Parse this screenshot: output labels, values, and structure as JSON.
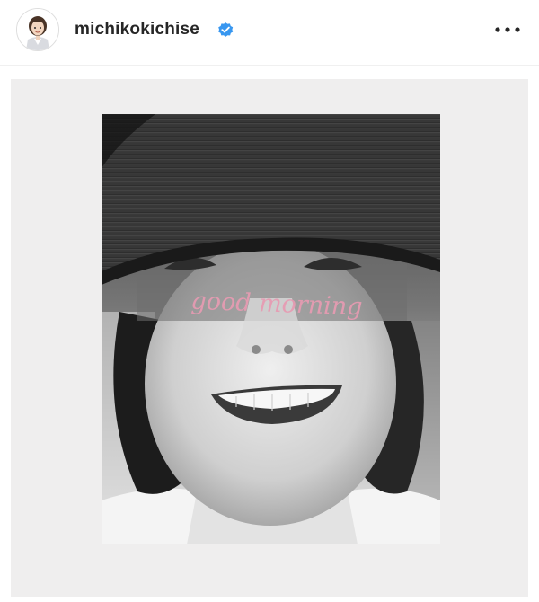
{
  "header": {
    "username": "michikokichise",
    "verified_badge": "verified-badge-icon",
    "more_icon": "more-options-icon"
  },
  "post": {
    "overlay_text": "good morning",
    "overlay_color": "#e79bb2"
  },
  "colors": {
    "verified_blue": "#3897f0",
    "post_background": "#efeeee"
  }
}
